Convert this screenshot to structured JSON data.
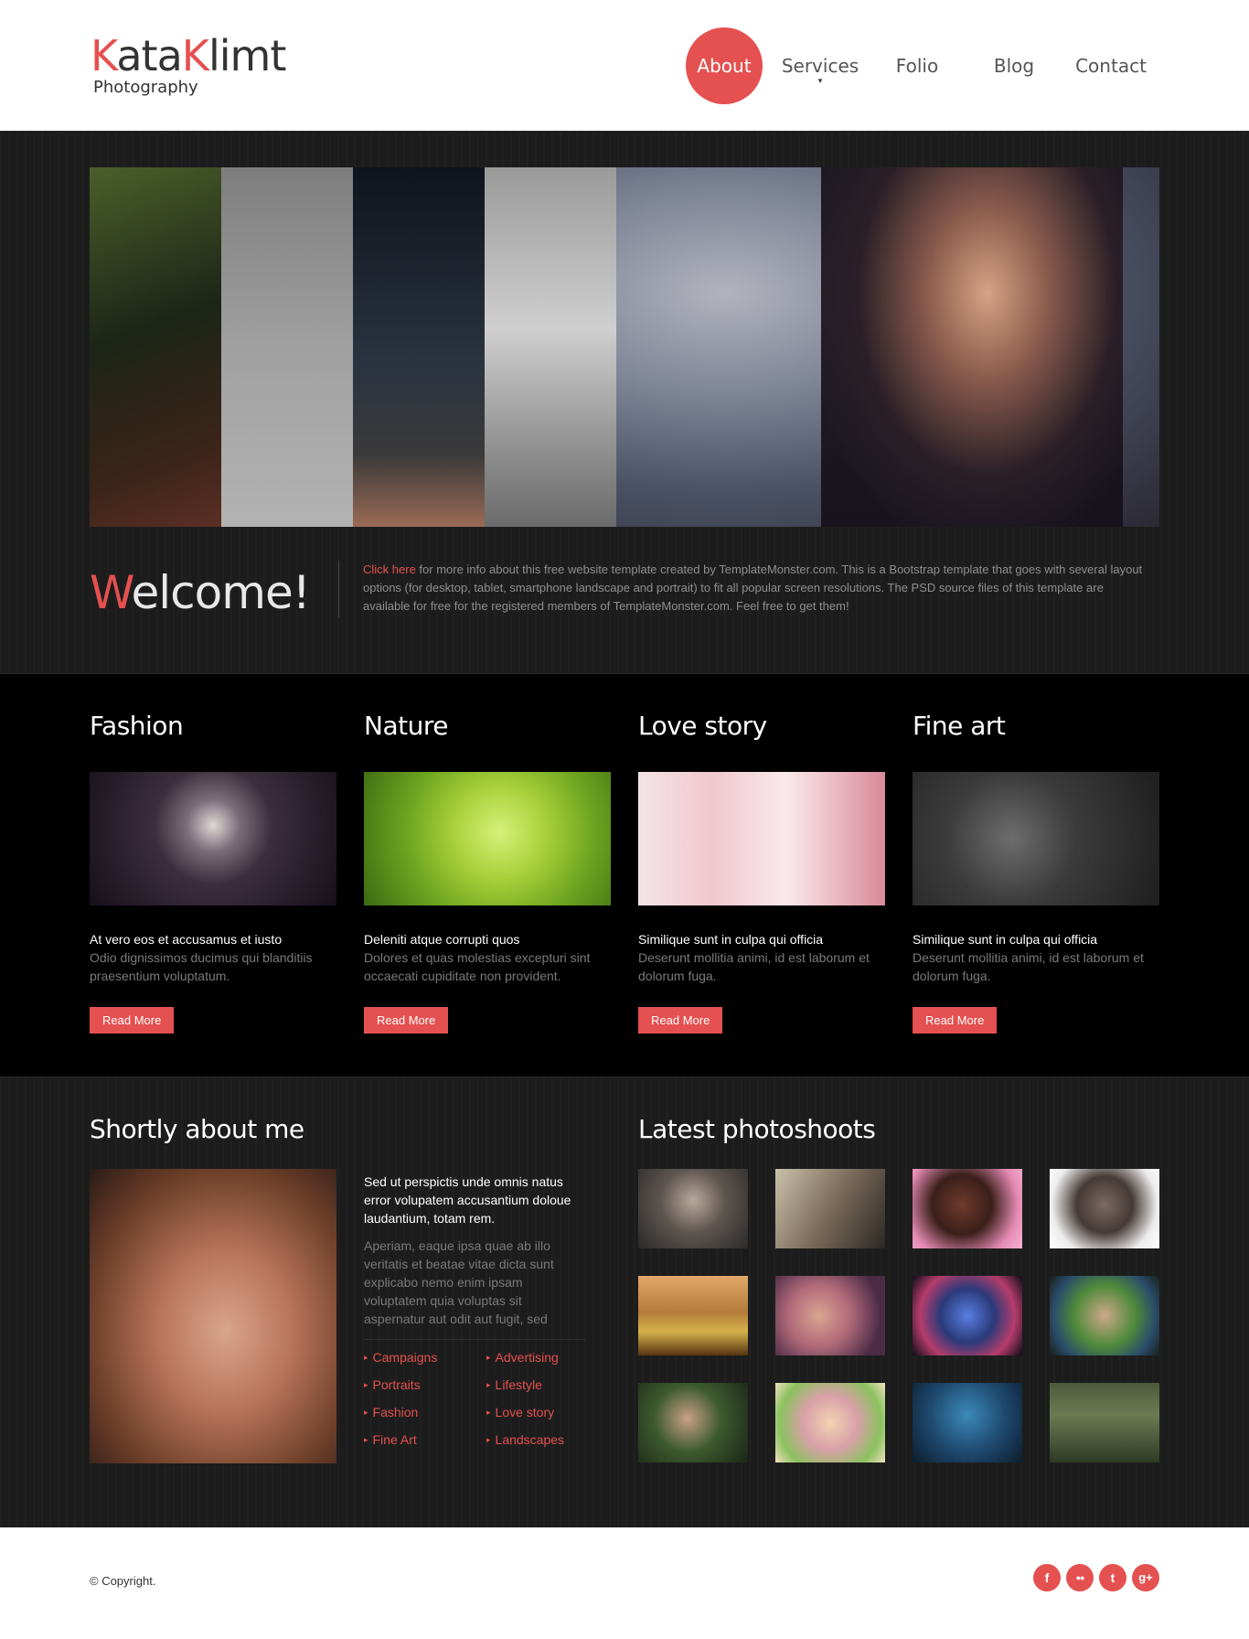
{
  "header": {
    "logo_first_k": "K",
    "logo_first_rest": "ata",
    "logo_second_k": "K",
    "logo_second_rest": "limt",
    "logo_subtitle": "Photography",
    "nav": [
      {
        "label": "About",
        "active": true
      },
      {
        "label": "Services",
        "active": false,
        "has_submenu": true
      },
      {
        "label": "Folio",
        "active": false
      },
      {
        "label": "Blog",
        "active": false
      },
      {
        "label": "Contact",
        "active": false
      }
    ]
  },
  "welcome": {
    "title_first_letter": "W",
    "title_rest": "elcome!",
    "link_text": "Click here",
    "text": " for more info about this free website template created by TemplateMonster.com. This is a Bootstrap template that goes with several layout options (for desktop, tablet, smartphone landscape and portrait) to fit all popular screen resolutions. The PSD source files of this template are available for free for the registered members of TemplateMonster.com. Feel free to get them!"
  },
  "categories": [
    {
      "title": "Fashion",
      "lead": "At vero eos et accusamus et iusto",
      "desc": "Odio dignissimos ducimus qui blanditiis praesentium voluptatum.",
      "button": "Read More"
    },
    {
      "title": "Nature",
      "lead": "Deleniti atque corrupti quos",
      "desc": "Dolores et quas molestias excepturi sint occaecati cupiditate non provident.",
      "button": "Read More"
    },
    {
      "title": "Love story",
      "lead": "Similique sunt in culpa qui officia",
      "desc": "Deserunt mollitia animi, id est laborum et dolorum fuga.",
      "button": "Read More"
    },
    {
      "title": "Fine art",
      "lead": "Similique sunt in culpa qui officia",
      "desc": "Deserunt mollitia animi, id est laborum et dolorum fuga.",
      "button": "Read More"
    }
  ],
  "about": {
    "title": "Shortly about me",
    "lead": "Sed ut perspictis unde omnis natus error volupatem accusantium doloue laudantium, totam rem.",
    "desc": "Aperiam, eaque ipsa quae ab illo veritatis et beatae vitae dicta sunt explicabo nemo enim ipsam voluptatem quia voluptas sit aspernatur aut odit aut fugit, sed",
    "links": [
      "Campaigns",
      "Advertising",
      "Portraits",
      "Lifestyle",
      "Fashion",
      "Love story",
      "Fine Art",
      "Landscapes"
    ]
  },
  "photoshoots": {
    "title": "Latest photoshoots",
    "count": 12
  },
  "footer": {
    "copyright": "© Copyright.",
    "social": [
      {
        "icon": "facebook-icon",
        "glyph": "f"
      },
      {
        "icon": "flickr-icon",
        "glyph": "●●"
      },
      {
        "icon": "twitter-icon",
        "glyph": "t"
      },
      {
        "icon": "google-plus-icon",
        "glyph": "g+"
      }
    ]
  },
  "colors": {
    "accent": "#e55050",
    "dark_bg": "#1c1c1c",
    "black_bg": "#000000"
  }
}
